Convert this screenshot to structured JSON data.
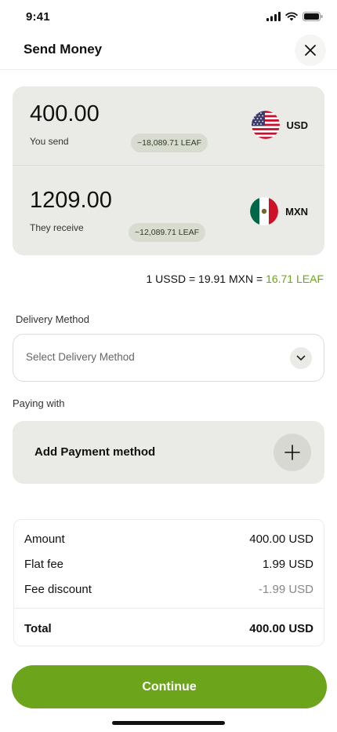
{
  "status": {
    "time": "9:41"
  },
  "header": {
    "title": "Send Money"
  },
  "send": {
    "amount": "400.00",
    "label": "You send",
    "leaf_estimate": "~18,089.71 LEAF",
    "currency": "USD",
    "flag": "us-flag-icon"
  },
  "receive": {
    "amount": "1209.00",
    "label": "They receive",
    "leaf_estimate": "~12,089.71 LEAF",
    "currency": "MXN",
    "flag": "mexico-flag-icon"
  },
  "rate": {
    "from": "1 USSD",
    "eq1": " = ",
    "to": "19.91 MXN",
    "eq2": " = ",
    "leaf": "16.71 LEAF"
  },
  "delivery": {
    "label": "Delivery Method",
    "placeholder": "Select Delivery Method"
  },
  "payment": {
    "label": "Paying with",
    "add_label": "Add Payment method"
  },
  "summary": {
    "rows": [
      {
        "label": "Amount",
        "value": "400.00 USD"
      },
      {
        "label": "Flat fee",
        "value": "1.99 USD"
      },
      {
        "label": "Fee discount",
        "value": "-1.99 USD"
      }
    ],
    "total": {
      "label": "Total",
      "value": "400.00 USD"
    }
  },
  "actions": {
    "continue_label": "Continue"
  },
  "colors": {
    "accent": "#6ca51c",
    "card": "#eaebe6",
    "pill": "#d8dcd0"
  }
}
